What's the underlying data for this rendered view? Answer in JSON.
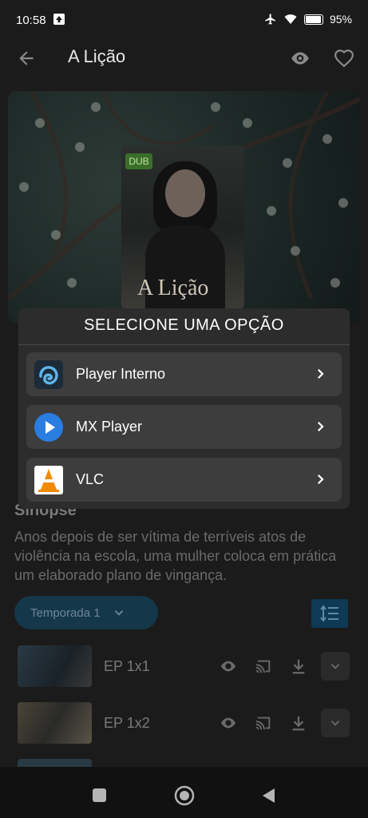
{
  "status": {
    "time": "10:58",
    "battery": "95%"
  },
  "appbar": {
    "title": "A Lição"
  },
  "poster": {
    "badge": "DUB",
    "title": "A Lição"
  },
  "content": {
    "synopsis_heading": "Sinopse",
    "synopsis": "Anos depois de ser vítima de terríveis atos de violência na escola, uma mulher coloca em prática um elaborado plano de vingança.",
    "season_label": "Temporada 1"
  },
  "episodes": [
    {
      "label": "EP 1x1"
    },
    {
      "label": "EP 1x2"
    }
  ],
  "dialog": {
    "title": "SELECIONE UMA OPÇÃO",
    "options": [
      {
        "label": "Player Interno",
        "icon": "player-interno-icon"
      },
      {
        "label": "MX Player",
        "icon": "mx-player-icon"
      },
      {
        "label": "VLC",
        "icon": "vlc-icon"
      }
    ]
  },
  "colors": {
    "accent": "#1f5c82",
    "dialog_bg": "#2c2c2c",
    "option_bg": "#3d3d3d"
  }
}
